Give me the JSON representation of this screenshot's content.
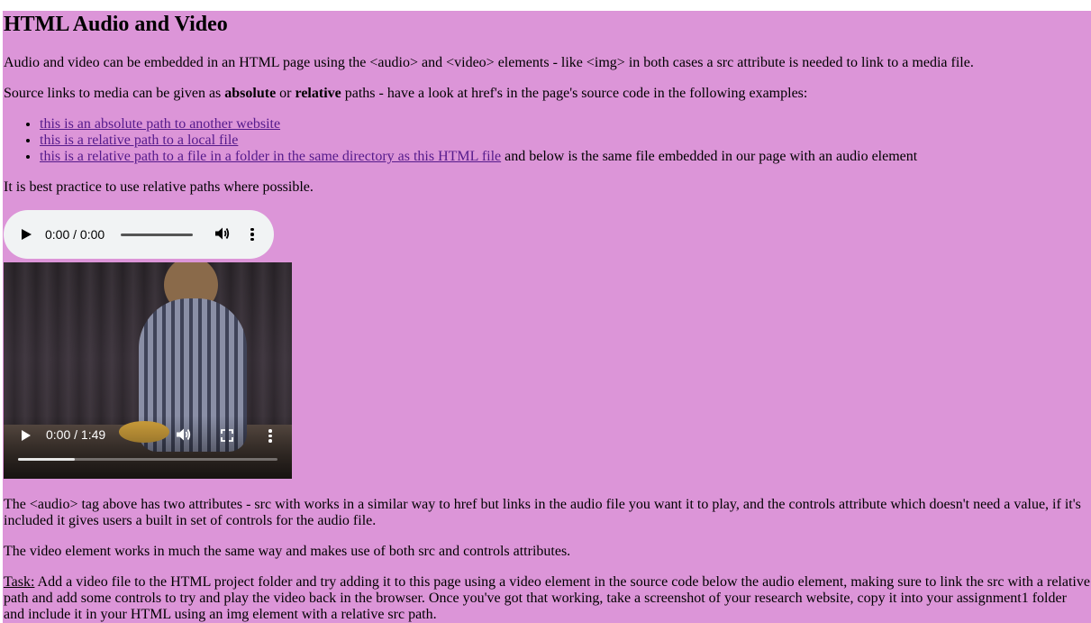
{
  "heading": "HTML Audio and Video",
  "intro": "Audio and video can be embedded in an HTML page using the <audio> and <video> elements - like <img> in both cases a src attribute is needed to link to a media file.",
  "source_text": {
    "before": "Source links to media can be given as ",
    "absolute": "absolute",
    "middle": " or ",
    "relative": "relative",
    "after": " paths - have a look at href's in the page's source code in the following examples:"
  },
  "links": [
    {
      "label": "this is an absolute path to another website",
      "suffix": ""
    },
    {
      "label": "this is a relative path to a local file",
      "suffix": ""
    },
    {
      "label": "this is a relative path to a file in a folder in the same directory as this HTML file",
      "suffix": " and below is the same file embedded in our page with an audio element"
    }
  ],
  "best_practice": "It is best practice to use relative paths where possible.",
  "audio_player": {
    "time": "0:00 / 0:00",
    "icons": [
      "play-icon",
      "volume-icon",
      "more-options-icon"
    ]
  },
  "video_player": {
    "time": "0:00 / 1:49",
    "progress": 0.22,
    "icons": [
      "play-icon",
      "volume-icon",
      "fullscreen-icon",
      "more-options-icon"
    ]
  },
  "audio_explanation": "The <audio> tag above has two attributes - src with works in a similar way to href but links in the audio file you want it to play, and the controls attribute which doesn't need a value, if it's included it gives users a built in set of controls for the audio file.",
  "video_explanation": "The video element works in much the same way and makes use of both src and controls attributes.",
  "task": {
    "label": "Task:",
    "text": " Add a video file to the HTML project folder and try adding it to this page using a video element in the source code below the audio element, making sure to link the src with a relative path and add some controls to try and play the video back in the browser. Once you've got that working, take a screenshot of your research website, copy it into your assignment1 folder and include it in your HTML using an img element with a relative src path."
  },
  "colors": {
    "page_background": "#dc95d8",
    "link": "#551a8b",
    "audio_player_bg": "#f1f3f4"
  }
}
